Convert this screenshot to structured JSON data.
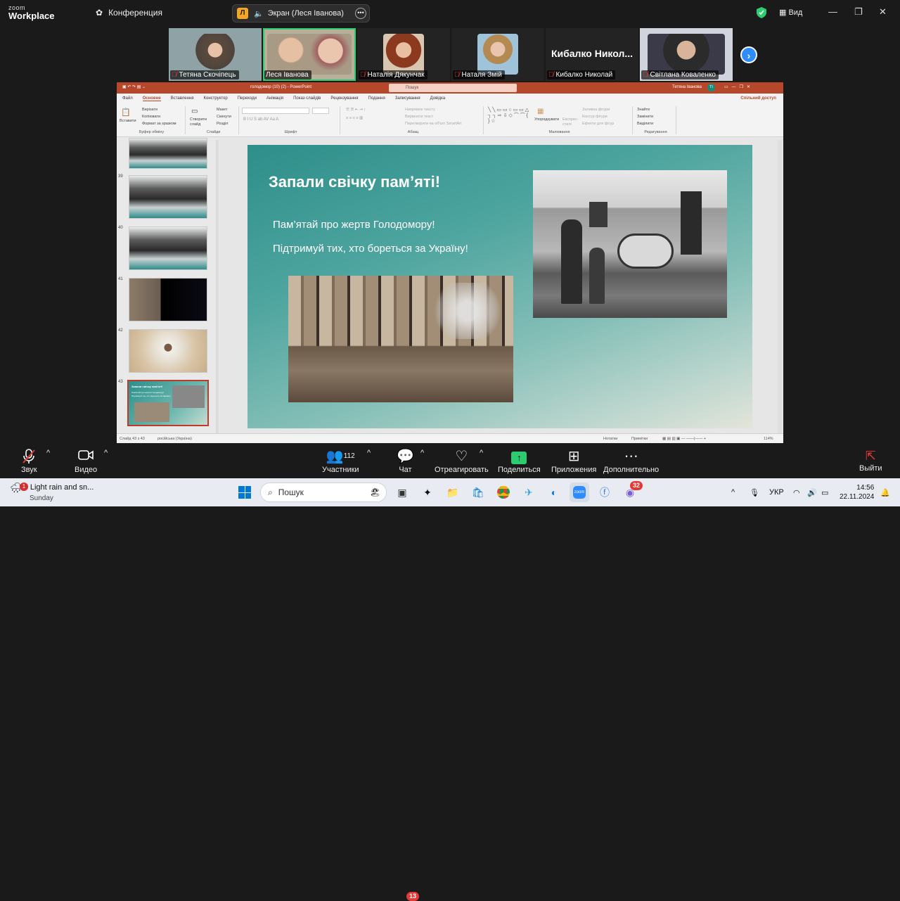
{
  "zoom": {
    "logo_top": "zoom",
    "logo_bottom": "Workplace",
    "meeting_label": "Конференция",
    "screen_share_label": "Экран (Леся Іванова)",
    "screen_share_avatar": "Л",
    "view_label": "Вид",
    "accent_color": "#2d8cff",
    "active_speaker_color": "#2ecc71"
  },
  "participants": [
    {
      "name": "Тетяна Скочіпець",
      "muted": true
    },
    {
      "name": "Леся Іванова",
      "muted": false,
      "active": true
    },
    {
      "name": "Наталія Дякунчак",
      "muted": true
    },
    {
      "name": "Наталя Змій",
      "muted": true
    },
    {
      "name": "Кибалко Николай",
      "muted": true,
      "big_label": "Кибалко Никол..."
    },
    {
      "name": "Світлана Коваленко",
      "muted": true
    }
  ],
  "ppt": {
    "filename": "голодомор (10) (2) - PowerPoint",
    "search_placeholder": "Пошук",
    "user": "Тетяна Іванова",
    "user_initials": "ТІ",
    "share_label": "Спільний доступ",
    "tabs": [
      "Файл",
      "Основне",
      "Вставлення",
      "Конструктор",
      "Переходи",
      "Анімація",
      "Показ слайдів",
      "Рецензування",
      "Подання",
      "Записування",
      "Довідка"
    ],
    "selected_tab": "Основне",
    "ribbon": {
      "clipboard": {
        "paste": "Вставити",
        "cut": "Вирізати",
        "copy": "Копіювати",
        "format": "Формат за зразком",
        "group": "Буфер обміну"
      },
      "slides": {
        "new": "Створити слайд",
        "layout": "Макет",
        "reset": "Скинути",
        "section": "Розділ",
        "group": "Слайди"
      },
      "font_group": "Шрифт",
      "paragraph": {
        "direction": "Напрямок тексту",
        "align": "Вирівняти текст",
        "smartart": "Перетворити на об'єкт SmartArt",
        "group": "Абзац"
      },
      "drawing": {
        "arrange": "Упорядкувати",
        "styles": "Експрес-стилі",
        "fill": "Заливка фігури",
        "outline": "Контур фігури",
        "effects": "Ефекти для фігур",
        "group": "Малювання"
      },
      "editing": {
        "find": "Знайти",
        "replace": "Замінити",
        "select": "Виділити",
        "group": "Редагування"
      }
    },
    "thumbnails": [
      {
        "num": "39"
      },
      {
        "num": "40"
      },
      {
        "num": "41"
      },
      {
        "num": "42"
      },
      {
        "num": "43"
      }
    ],
    "slide": {
      "title": "Запали свічку пам’яті!",
      "line1": "Пам’ятай про жертв Голодомору!",
      "line2": "Підтримуй тих, хто бореться за Україну!"
    },
    "thumb43": {
      "title": "Запали свічку пам'яті!",
      "text": "Пам'ятай про жертв Голодомору! Підтримуй тих, хто бореться за Україну!"
    },
    "status": {
      "slide": "Слайд 43 з 43",
      "lang": "російська (Україна)",
      "notes": "Нотатки",
      "comments": "Примітки",
      "zoom": "114%"
    }
  },
  "controls": {
    "audio": "Звук",
    "video": "Видео",
    "participants": "Участники",
    "participants_count": "112",
    "chat": "Чат",
    "chat_badge": "13",
    "react": "Отреагировать",
    "share": "Поделиться",
    "apps": "Приложения",
    "more": "Дополнительно",
    "leave": "Выйти"
  },
  "taskbar": {
    "weather": "Light rain and sn...",
    "weather_sub": "Sunday",
    "weather_badge": "1",
    "search": "Пошук",
    "lang": "УКР",
    "time": "14:56",
    "date": "22.11.2024",
    "messenger_badge": "32"
  }
}
